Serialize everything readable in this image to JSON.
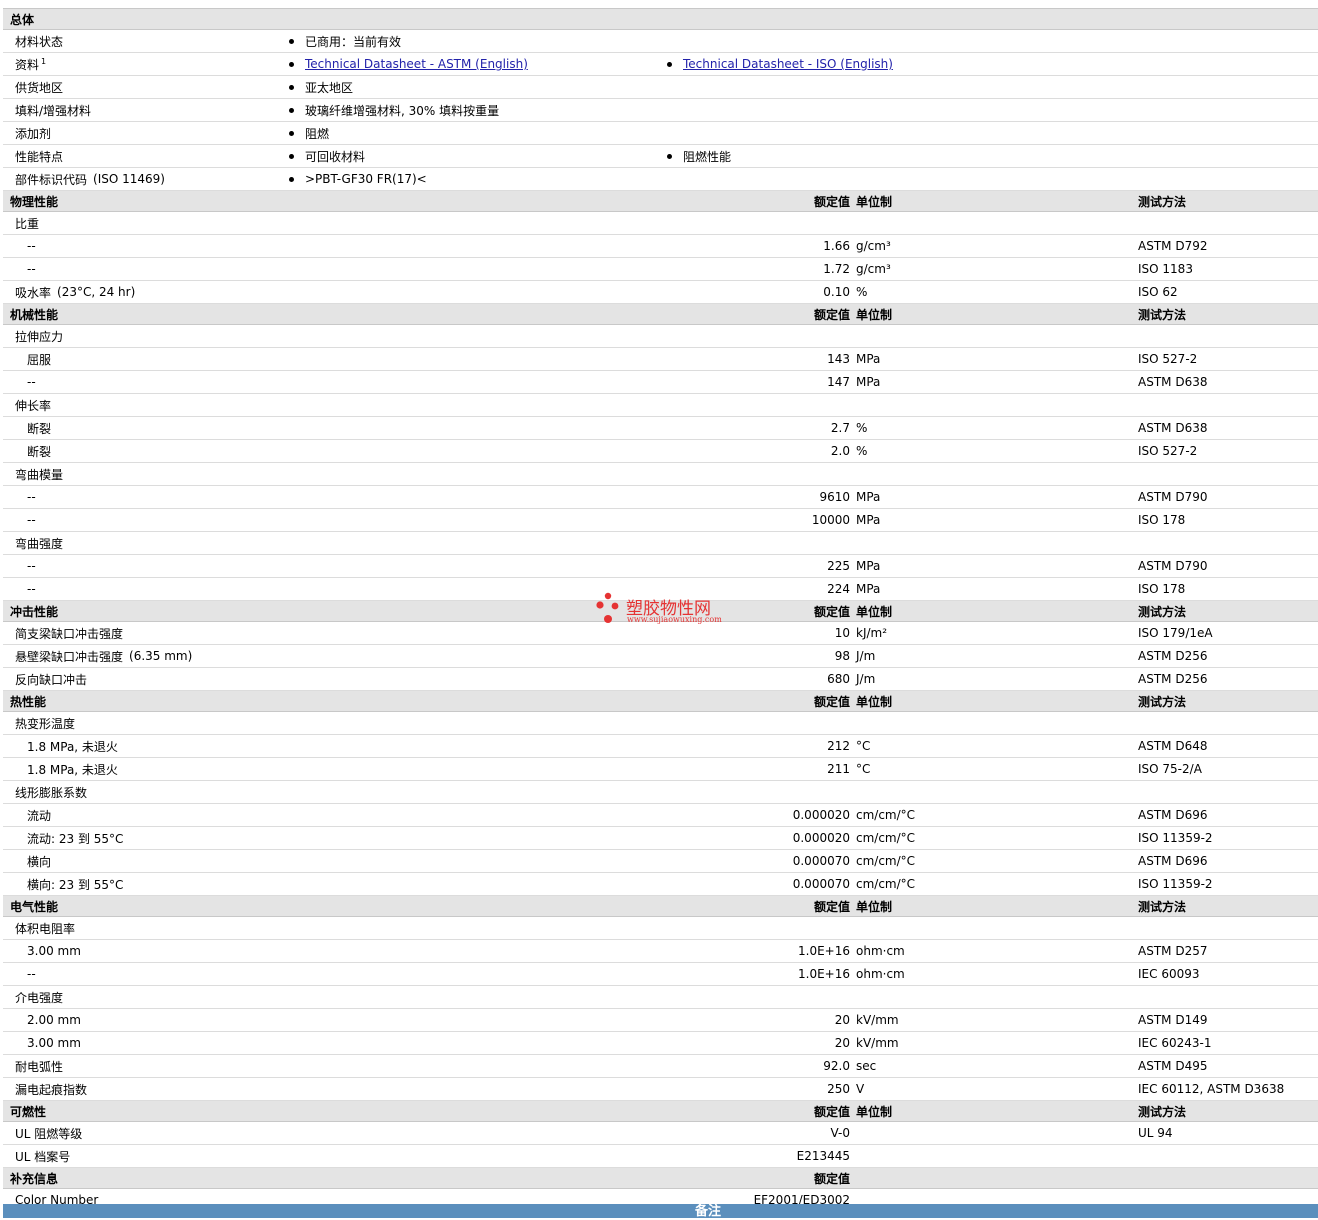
{
  "general": {
    "title": "总体",
    "rows": [
      {
        "label": "材料状态",
        "values": [
          "已商用：当前有效"
        ]
      },
      {
        "label": "资料",
        "sup": "1",
        "links": [
          "Technical Datasheet - ASTM (English)",
          "Technical Datasheet - ISO (English)"
        ]
      },
      {
        "label": "供货地区",
        "values": [
          "亚太地区"
        ]
      },
      {
        "label": "填料/增强材料",
        "values": [
          "玻璃纤维增强材料, 30% 填料按重量"
        ]
      },
      {
        "label": "添加剂",
        "values": [
          "阻燃"
        ]
      },
      {
        "label": "性能特点",
        "values": [
          "可回收材料",
          "阻燃性能"
        ]
      },
      {
        "label": "部件标识代码",
        "cond": "(ISO 11469)",
        "values": [
          ">PBT-GF30 FR(17)<"
        ]
      }
    ]
  },
  "headers": {
    "value": "额定值",
    "unit": "单位制",
    "test": "测试方法"
  },
  "sections": [
    {
      "title": "物理性能",
      "rows": [
        {
          "label": "比重",
          "group": true
        },
        {
          "label": "--",
          "sub": true,
          "value": "1.66",
          "unit": "g/cm³",
          "test": "ASTM D792"
        },
        {
          "label": "--",
          "sub": true,
          "value": "1.72",
          "unit": "g/cm³",
          "test": "ISO 1183"
        },
        {
          "label": "吸水率",
          "cond": "(23°C, 24 hr)",
          "value": "0.10",
          "unit": "%",
          "test": "ISO 62"
        }
      ]
    },
    {
      "title": "机械性能",
      "rows": [
        {
          "label": "拉伸应力",
          "group": true
        },
        {
          "label": "屈服",
          "sub": true,
          "value": "143",
          "unit": "MPa",
          "test": "ISO 527-2"
        },
        {
          "label": "--",
          "sub": true,
          "value": "147",
          "unit": "MPa",
          "test": "ASTM D638"
        },
        {
          "label": "伸长率",
          "group": true
        },
        {
          "label": "断裂",
          "sub": true,
          "value": "2.7",
          "unit": "%",
          "test": "ASTM D638"
        },
        {
          "label": "断裂",
          "sub": true,
          "value": "2.0",
          "unit": "%",
          "test": "ISO 527-2"
        },
        {
          "label": "弯曲模量",
          "group": true
        },
        {
          "label": "--",
          "sub": true,
          "value": "9610",
          "unit": "MPa",
          "test": "ASTM D790"
        },
        {
          "label": "--",
          "sub": true,
          "value": "10000",
          "unit": "MPa",
          "test": "ISO 178"
        },
        {
          "label": "弯曲强度",
          "group": true
        },
        {
          "label": "--",
          "sub": true,
          "value": "225",
          "unit": "MPa",
          "test": "ASTM D790"
        },
        {
          "label": "--",
          "sub": true,
          "value": "224",
          "unit": "MPa",
          "test": "ISO 178"
        }
      ]
    },
    {
      "title": "冲击性能",
      "rows": [
        {
          "label": "简支梁缺口冲击强度",
          "value": "10",
          "unit": "kJ/m²",
          "test": "ISO 179/1eA"
        },
        {
          "label": "悬壁梁缺口冲击强度",
          "cond": "(6.35 mm)",
          "value": "98",
          "unit": "J/m",
          "test": "ASTM D256"
        },
        {
          "label": "反向缺口冲击",
          "value": "680",
          "unit": "J/m",
          "test": "ASTM D256"
        }
      ]
    },
    {
      "title": "热性能",
      "rows": [
        {
          "label": "热变形温度",
          "group": true
        },
        {
          "label": "1.8 MPa, 未退火",
          "sub": true,
          "value": "212",
          "unit": "°C",
          "test": "ASTM D648"
        },
        {
          "label": "1.8 MPa, 未退火",
          "sub": true,
          "value": "211",
          "unit": "°C",
          "test": "ISO 75-2/A"
        },
        {
          "label": "线形膨胀系数",
          "group": true
        },
        {
          "label": "流动",
          "sub": true,
          "value": "0.000020",
          "unit": "cm/cm/°C",
          "test": "ASTM D696"
        },
        {
          "label": "流动: 23 到  55°C",
          "sub": true,
          "value": "0.000020",
          "unit": "cm/cm/°C",
          "test": "ISO 11359-2"
        },
        {
          "label": "横向",
          "sub": true,
          "value": "0.000070",
          "unit": "cm/cm/°C",
          "test": "ASTM D696"
        },
        {
          "label": "横向: 23 到  55°C",
          "sub": true,
          "value": "0.000070",
          "unit": "cm/cm/°C",
          "test": "ISO 11359-2"
        }
      ]
    },
    {
      "title": "电气性能",
      "rows": [
        {
          "label": "体积电阻率",
          "group": true
        },
        {
          "label": "3.00 mm",
          "sub": true,
          "value": "1.0E+16",
          "unit": "ohm·cm",
          "test": "ASTM D257"
        },
        {
          "label": "--",
          "sub": true,
          "value": "1.0E+16",
          "unit": "ohm·cm",
          "test": "IEC 60093"
        },
        {
          "label": "介电强度",
          "group": true
        },
        {
          "label": "2.00 mm",
          "sub": true,
          "value": "20",
          "unit": "kV/mm",
          "test": "ASTM D149"
        },
        {
          "label": "3.00 mm",
          "sub": true,
          "value": "20",
          "unit": "kV/mm",
          "test": "IEC 60243-1"
        },
        {
          "label": "耐电弧性",
          "value": "92.0",
          "unit": "sec",
          "test": "ASTM D495"
        },
        {
          "label": "漏电起痕指数",
          "value": "250",
          "unit": "V",
          "test": "IEC 60112, ASTM D3638"
        }
      ]
    },
    {
      "title": "可燃性",
      "rows": [
        {
          "label": "UL 阻燃等级",
          "value": "V-0",
          "unit": "",
          "test": "UL 94"
        },
        {
          "label": "UL 档案号",
          "value": "E213445",
          "unit": "",
          "test": ""
        }
      ]
    },
    {
      "title": "补充信息",
      "valueOnly": true,
      "rows": [
        {
          "label": "Color Number",
          "value": "EF2001/ED3002",
          "unit": "",
          "test": ""
        }
      ]
    }
  ],
  "notes": {
    "title": "备注"
  },
  "watermark": {
    "text": "塑胶物性网",
    "url": "www.sujiaowuxing.com",
    "color": "#e53333"
  }
}
